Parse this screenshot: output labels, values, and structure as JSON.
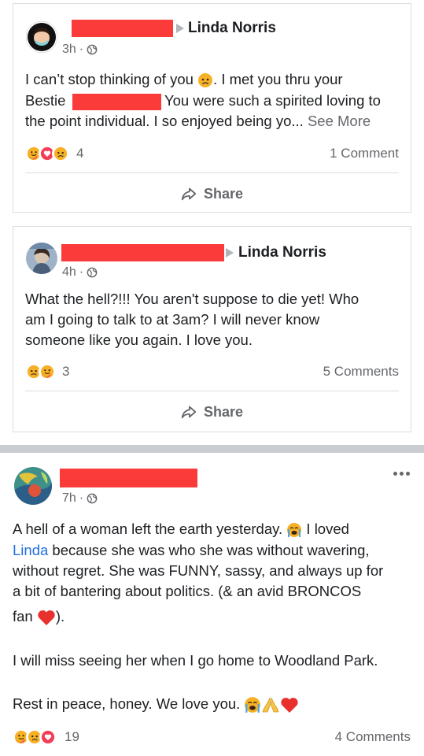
{
  "posts": [
    {
      "target_name": "Linda Norris",
      "time": "3h",
      "lines": {
        "l1": "I can’t stop thinking of you",
        "l1b": ". I met you thru your",
        "l2a": "Bestie",
        "l2b": "You were such a spirited loving to",
        "l3": "the point individual. I so enjoyed being yo...",
        "see_more": "See More"
      },
      "reaction_count": "4",
      "comments": "1 Comment",
      "share_label": "Share"
    },
    {
      "target_name": "Linda Norris",
      "time": "4h",
      "lines": {
        "l1": "What the hell?!!!  You aren't suppose to die yet!  Who",
        "l2": "am I going to talk to at 3am?  I  will never know",
        "l3": "someone like you again.  I love you."
      },
      "reaction_count": "3",
      "comments": "5 Comments",
      "share_label": "Share"
    },
    {
      "time": "7h",
      "lines": {
        "l1a": "A hell of a woman left the earth yesterday.",
        "l1b": "I loved",
        "l2_link": "Linda",
        "l2b": "because she was who she was without wavering,",
        "l3": "without regret. She was FUNNY, sassy, and always up for",
        "l4": "a bit of bantering about politics. (& an avid BRONCOS",
        "l5a": "fan",
        "l5b": ").",
        "l6": "I will miss seeing her when I go home to Woodland Park.",
        "l7": "Rest in peace, honey. We love you."
      },
      "reaction_count": "19",
      "comments": "4 Comments"
    }
  ],
  "colors": {
    "redaction": "#fb3a3a",
    "link": "#216fdb",
    "muted": "#65676b"
  },
  "icons": [
    "globe-icon",
    "share-icon",
    "more-icon",
    "care-reaction-icon",
    "love-reaction-icon",
    "sad-reaction-icon",
    "crying-emoji-icon",
    "folded-hands-emoji-icon",
    "red-heart-emoji-icon"
  ]
}
